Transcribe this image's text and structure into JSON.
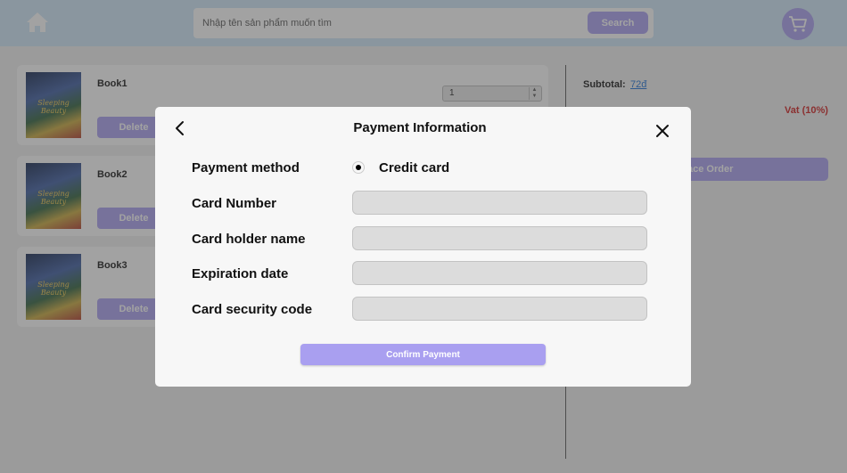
{
  "header": {
    "search": {
      "placeholder": "Nhập tên sản phẩm muốn tìm",
      "button_label": "Search"
    }
  },
  "cart": {
    "items": [
      {
        "name": "Book1",
        "cover_text": "Sleeping Beauty",
        "delete_label": "Delete",
        "quantity": "1"
      },
      {
        "name": "Book2",
        "cover_text": "Sleeping Beauty",
        "delete_label": "Delete"
      },
      {
        "name": "Book3",
        "cover_text": "Sleeping Beauty",
        "delete_label": "Delete"
      }
    ]
  },
  "summary": {
    "subtotal_label": "Subtotal:",
    "subtotal_value": "72đ",
    "vat_label": "Vat (10%)",
    "place_order_label": "Place Order"
  },
  "modal": {
    "title": "Payment Information",
    "fields": {
      "payment_method_label": "Payment method",
      "payment_method_option": "Credit card",
      "card_number_label": "Card Number",
      "card_holder_label": "Card holder name",
      "expiration_label": "Expiration date",
      "security_code_label": "Card security code"
    },
    "confirm_label": "Confirm Payment"
  },
  "colors": {
    "accent": "#a99ff0",
    "header_bg": "#cfe6f8",
    "vat_red": "#d01a1a",
    "link_blue": "#1b6fd6"
  },
  "icons": {
    "home": "home-icon",
    "cart": "cart-icon",
    "back": "chevron-left-icon",
    "close": "close-icon"
  }
}
